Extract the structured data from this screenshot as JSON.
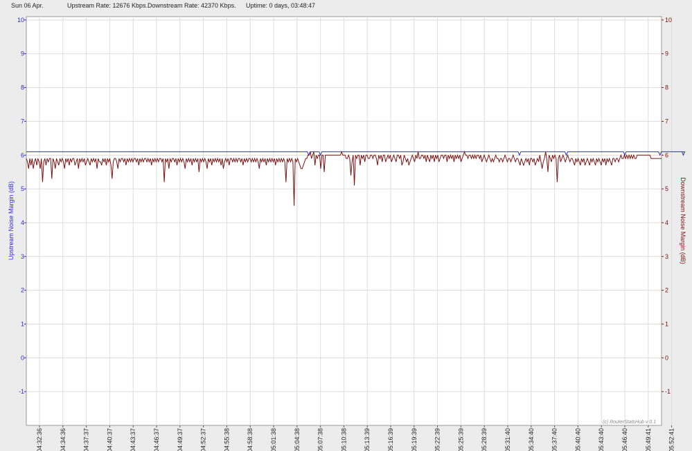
{
  "header": {
    "date": "Sun 06 Apr.",
    "upstream_rate": "Upstream Rate: 12676 Kbps.",
    "downstream_rate": "Downstream Rate: 42370 Kbps.",
    "uptime": "Uptime: 0 days, 03:48:47"
  },
  "watermark": "(c) RouterStatsHub v 0.1",
  "colors": {
    "upstream": "#2a2ad8",
    "downstream": "#7a1010",
    "left_axis": "#2a2ad8",
    "right_axis": "#7a1010",
    "grid": "#dcdcdc",
    "plot_bg": "#ffffff",
    "page_bg": "#ececec"
  },
  "chart_data": {
    "type": "line",
    "ylabel_left": "Upstream Noise Margin (dB)",
    "ylabel_right": "Downstream Noise Margin (dB)",
    "ylim": [
      -2,
      10.1
    ],
    "yticks": [
      10,
      9,
      8,
      7,
      6,
      5,
      4,
      3,
      2,
      1,
      0,
      -1
    ],
    "xticks": [
      "04:32:36",
      "04:34:36",
      "04:37:37",
      "04:40:37",
      "04:43:37",
      "04:46:37",
      "04:49:37",
      "04:52:37",
      "04:55:38",
      "04:58:38",
      "05:01:38",
      "05:04:38",
      "05:07:38",
      "05:10:38",
      "05:13:39",
      "05:16:39",
      "05:19:39",
      "05:22:39",
      "05:25:39",
      "05:28:39",
      "05:31:40",
      "05:34:40",
      "05:37:40",
      "05:40:40",
      "05:43:40",
      "05:46:40",
      "05:49:41",
      "05:52:41"
    ],
    "grid": true,
    "series": [
      {
        "name": "Upstream Noise Margin (dB)",
        "axis": "left",
        "baseline": 6.1,
        "dips": [
          [
            11.5,
            6.0
          ],
          [
            12.0,
            6.0
          ],
          [
            20.5,
            6.0
          ],
          [
            22.5,
            6.0
          ],
          [
            25.0,
            6.0
          ],
          [
            26.5,
            6.0
          ],
          [
            27.5,
            6.0
          ]
        ]
      },
      {
        "name": "Downstream Noise Margin (dB)",
        "axis": "right",
        "values": [
          5.9,
          5.8,
          5.6,
          5.9,
          5.7,
          5.9,
          5.6,
          5.8,
          5.9,
          5.7,
          5.9,
          5.8,
          5.6,
          5.9,
          5.2,
          5.8,
          5.9,
          5.7,
          5.9,
          5.8,
          5.9,
          5.9,
          5.3,
          5.9,
          5.8,
          5.6,
          5.9,
          5.8,
          5.7,
          5.9,
          5.8,
          5.9,
          5.8,
          5.6,
          5.9,
          5.8,
          5.9,
          5.7,
          5.9,
          5.8,
          5.9,
          5.9,
          5.7,
          5.8,
          5.9,
          5.6,
          5.9,
          5.8,
          5.9,
          5.8,
          5.9,
          5.7,
          5.8,
          5.9,
          5.8,
          5.7,
          5.9,
          5.8,
          5.9,
          5.8,
          5.9,
          5.6,
          5.9,
          5.8,
          5.8,
          5.7,
          5.9,
          5.8,
          5.9,
          5.7,
          5.9,
          5.8,
          5.9,
          5.7,
          5.3,
          5.8,
          5.9,
          5.9,
          5.8,
          5.6,
          5.9,
          5.8,
          5.9,
          5.9,
          5.8,
          5.9,
          5.7,
          5.9,
          5.8,
          5.9,
          5.8,
          5.9,
          5.8,
          5.9,
          5.9,
          5.8,
          5.9,
          5.7,
          5.9,
          5.8,
          5.9,
          5.8,
          5.9,
          5.9,
          5.8,
          5.9,
          5.8,
          5.9,
          5.7,
          5.9,
          5.8,
          5.9,
          5.8,
          5.9,
          5.8,
          5.9,
          5.9,
          5.8,
          5.9,
          5.2,
          5.9,
          5.8,
          5.9,
          5.6,
          5.9,
          5.8,
          5.9,
          5.9,
          5.8,
          5.9,
          5.7,
          5.9,
          5.8,
          5.9,
          5.8,
          5.9,
          5.8,
          5.6,
          5.9,
          5.8,
          5.9,
          5.8,
          5.9,
          5.7,
          5.9,
          5.8,
          5.9,
          5.8,
          5.9,
          5.5,
          5.9,
          5.8,
          5.9,
          5.8,
          5.9,
          5.8,
          5.6,
          5.9,
          5.8,
          5.9,
          5.7,
          5.9,
          5.8,
          5.9,
          5.8,
          5.9,
          5.8,
          5.9,
          5.7,
          5.9,
          5.6,
          5.8,
          5.9,
          5.8,
          5.9,
          5.7,
          5.9,
          5.9,
          5.8,
          5.9,
          5.8,
          5.9,
          5.8,
          5.9,
          5.9,
          5.8,
          5.9,
          5.7,
          5.9,
          5.8,
          5.9,
          5.8,
          5.9,
          5.9,
          5.8,
          5.9,
          5.8,
          5.9,
          5.8,
          5.9,
          5.8,
          5.6,
          5.9,
          5.8,
          5.9,
          5.8,
          5.9,
          5.7,
          5.9,
          5.8,
          5.9,
          5.8,
          5.9,
          5.8,
          5.9,
          5.7,
          5.9,
          5.8,
          5.9,
          5.8,
          5.9,
          5.8,
          5.9,
          5.8,
          5.2,
          5.9,
          5.8,
          5.9,
          5.8,
          5.9,
          5.8,
          4.5,
          5.9,
          5.8,
          5.9,
          5.8,
          5.7,
          5.6,
          5.6,
          5.7,
          5.8,
          5.9,
          5.9,
          6.0,
          6.0,
          6.1,
          5.9,
          6.0,
          6.1,
          5.7,
          6.0,
          5.9,
          6.0,
          6.0,
          5.6,
          6.0,
          6.0,
          5.5,
          6.0,
          6.0,
          6.0,
          6.0,
          6.0,
          6.0,
          6.0,
          6.0,
          6.0,
          6.0,
          6.0,
          6.0,
          6.0,
          6.0,
          6.1,
          6.0,
          6.0,
          6.0,
          5.9,
          5.9,
          6.0,
          5.9,
          5.4,
          5.8,
          6.0,
          5.1,
          6.0,
          5.9,
          6.0,
          6.0,
          5.7,
          6.0,
          5.9,
          6.0,
          5.8,
          6.0,
          6.0,
          5.9,
          5.9,
          6.0,
          6.0,
          5.9,
          6.0,
          6.0,
          5.9,
          5.7,
          6.0,
          5.9,
          6.0,
          5.8,
          6.0,
          6.0,
          5.8,
          5.9,
          6.0,
          5.9,
          6.0,
          5.8,
          5.9,
          6.0,
          5.9,
          5.8,
          6.0,
          6.0,
          5.9,
          6.0,
          5.7,
          5.8,
          6.0,
          5.9,
          5.8,
          5.9,
          5.7,
          5.8,
          5.9,
          6.0,
          5.9,
          5.8,
          6.0,
          5.9,
          6.1,
          5.9,
          5.9,
          6.0,
          6.0,
          5.9,
          6.0,
          5.8,
          6.0,
          5.9,
          5.8,
          6.0,
          5.9,
          6.0,
          5.8,
          6.0,
          5.9,
          6.0,
          5.8,
          5.9,
          6.0,
          6.0,
          5.9,
          6.0,
          6.0,
          5.8,
          6.0,
          5.9,
          6.0,
          5.9,
          6.0,
          5.8,
          6.0,
          5.9,
          6.0,
          5.9,
          6.0,
          5.8,
          5.9,
          6.0,
          6.1,
          6.0,
          6.0,
          5.9,
          6.0,
          6.0,
          5.9,
          6.0,
          5.9,
          6.0,
          5.9,
          6.0,
          6.0,
          5.9,
          6.0,
          5.8,
          5.9,
          6.0,
          5.9,
          5.8,
          5.9,
          6.0,
          5.9,
          5.8,
          5.9,
          5.8,
          5.9,
          6.0,
          5.9,
          5.9,
          5.8,
          5.9,
          5.9,
          5.8,
          5.9,
          6.0,
          5.9,
          5.8,
          5.9,
          5.9,
          5.8,
          5.9,
          6.0,
          5.9,
          5.8,
          5.9,
          5.9,
          5.8,
          5.7,
          5.9,
          5.8,
          5.7,
          5.8,
          5.9,
          5.8,
          5.9,
          5.7,
          5.9,
          5.9,
          5.8,
          5.9,
          5.7,
          5.8,
          5.9,
          5.8,
          6.0,
          5.8,
          5.6,
          5.8,
          5.9,
          6.1,
          5.9,
          5.5,
          6.0,
          5.9,
          5.8,
          6.0,
          5.9,
          6.0,
          5.9,
          5.2,
          5.9,
          6.0,
          5.8,
          5.9,
          6.0,
          5.9,
          5.8,
          5.9,
          6.0,
          5.9,
          5.8,
          5.9,
          5.9,
          5.8,
          5.7,
          5.9,
          5.8,
          5.9,
          5.8,
          5.7,
          5.9,
          5.8,
          5.9,
          5.7,
          5.8,
          5.9,
          5.8,
          5.7,
          5.9,
          5.8,
          5.9,
          5.8,
          5.7,
          5.9,
          5.8,
          5.9,
          5.8,
          5.7,
          5.9,
          5.8,
          5.9,
          5.7,
          5.9,
          5.8,
          5.9,
          5.8,
          5.7,
          5.9,
          5.9,
          5.8,
          5.9,
          5.9,
          5.8,
          5.9,
          6.0,
          5.9,
          5.9,
          6.0,
          5.9,
          6.0,
          5.9,
          6.0,
          5.9,
          6.0,
          5.9,
          6.0,
          5.9,
          5.9,
          6.0,
          6.0,
          6.0,
          6.0,
          6.0,
          6.0,
          6.0,
          6.0,
          6.0,
          6.0,
          6.0,
          6.0,
          5.9,
          5.9,
          5.9,
          5.9,
          5.9,
          5.9,
          5.9,
          5.9,
          5.9,
          5.9
        ]
      }
    ]
  }
}
